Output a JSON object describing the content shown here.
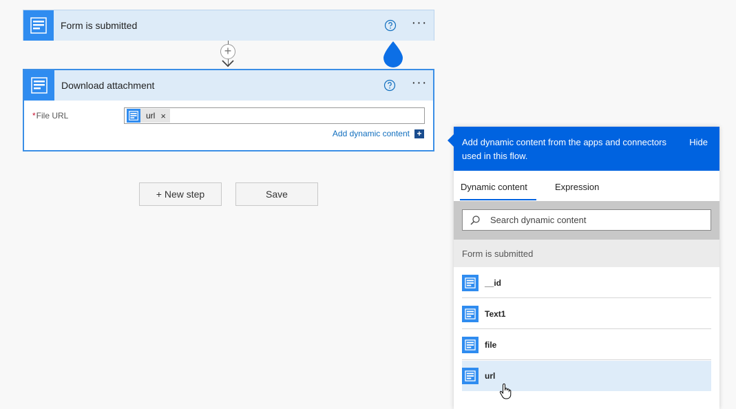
{
  "steps": [
    {
      "title": "Form is submitted"
    },
    {
      "title": "Download attachment"
    }
  ],
  "download": {
    "field_label": "File URL",
    "required_mark": "*",
    "token_label": "url",
    "token_remove": "×",
    "add_dynamic": "Add dynamic content",
    "add_dynamic_icon": "+"
  },
  "connector": {
    "plus": "+"
  },
  "buttons": {
    "new_step": "+ New step",
    "save": "Save"
  },
  "more_glyph": "···",
  "panel": {
    "message": "Add dynamic content from the apps and connectors used in this flow.",
    "hide": "Hide",
    "tabs": [
      "Dynamic content",
      "Expression"
    ],
    "active_tab": "Dynamic content",
    "search_placeholder": "Search dynamic content",
    "section": "Form is submitted",
    "items": [
      "__id",
      "Text1",
      "file",
      "url"
    ],
    "hovered_item": "url"
  },
  "colors": {
    "accent": "#0063e0",
    "icon_blue": "#2f8cf0",
    "header_bg": "#ddebf8",
    "hover_bg": "#deecf9"
  }
}
